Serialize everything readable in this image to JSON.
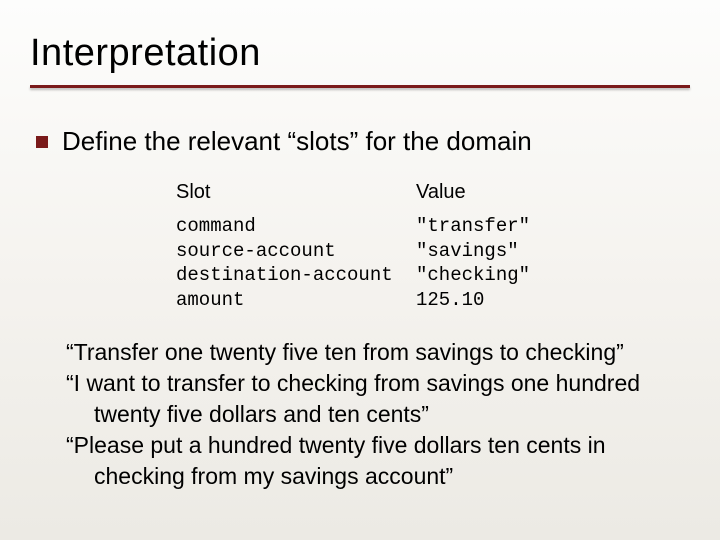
{
  "title": "Interpretation",
  "bullet": "Define the relevant “slots” for the domain",
  "table": {
    "headers": {
      "slot": "Slot",
      "value": "Value"
    },
    "rows": [
      {
        "slot": "command",
        "value": "\"transfer\""
      },
      {
        "slot": "source-account",
        "value": "\"savings\""
      },
      {
        "slot": "destination-account",
        "value": "\"checking\""
      },
      {
        "slot": "amount",
        "value": "125.10"
      }
    ]
  },
  "examples": [
    "“Transfer one twenty five ten from savings to checking”",
    "“I want to transfer to checking from savings one hundred twenty five dollars and ten cents”",
    "“Please put a hundred twenty five dollars ten cents in checking from my savings account”"
  ]
}
